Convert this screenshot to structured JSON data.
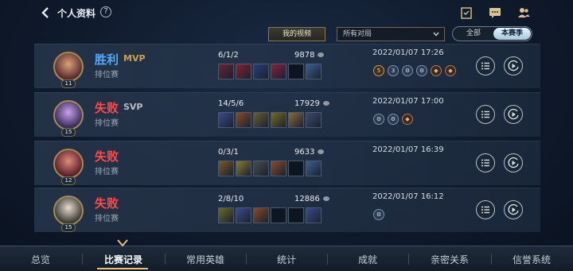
{
  "header": {
    "title": "个人资料",
    "help": "?",
    "icons": [
      "task-icon",
      "chat-icon",
      "friends-icon"
    ]
  },
  "filters": {
    "my_video": "我的视频",
    "match_select": "所有对局",
    "seg_all": "全部",
    "seg_season": "本赛季"
  },
  "matches": [
    {
      "result": "胜利",
      "result_type": "win",
      "tag": "MVP",
      "mode": "排位赛",
      "level": "11",
      "kda": "6/1/2",
      "gold": "9878",
      "time": "2022/01/07 17:26",
      "medals": [
        "5",
        "3",
        "⚙",
        "⚙",
        "◆",
        "◆"
      ]
    },
    {
      "result": "失败",
      "result_type": "lose",
      "tag": "SVP",
      "mode": "排位赛",
      "level": "15",
      "kda": "14/5/6",
      "gold": "17929",
      "time": "2022/01/07 17:00",
      "medals": [
        "⚙",
        "⚙",
        "◆"
      ]
    },
    {
      "result": "失败",
      "result_type": "lose",
      "tag": "",
      "mode": "排位赛",
      "level": "12",
      "kda": "0/3/1",
      "gold": "9633",
      "time": "2022/01/07 16:39",
      "medals": []
    },
    {
      "result": "失败",
      "result_type": "lose",
      "tag": "",
      "mode": "排位赛",
      "level": "15",
      "kda": "2/8/10",
      "gold": "12886",
      "time": "2022/01/07 16:12",
      "medals": [
        "⚙"
      ]
    }
  ],
  "nav": {
    "overview": "总览",
    "match_records": "比赛记录",
    "heroes": "常用英雄",
    "stats": "统计",
    "achievements": "成就",
    "relations": "亲密关系",
    "honor": "信誉系统"
  }
}
